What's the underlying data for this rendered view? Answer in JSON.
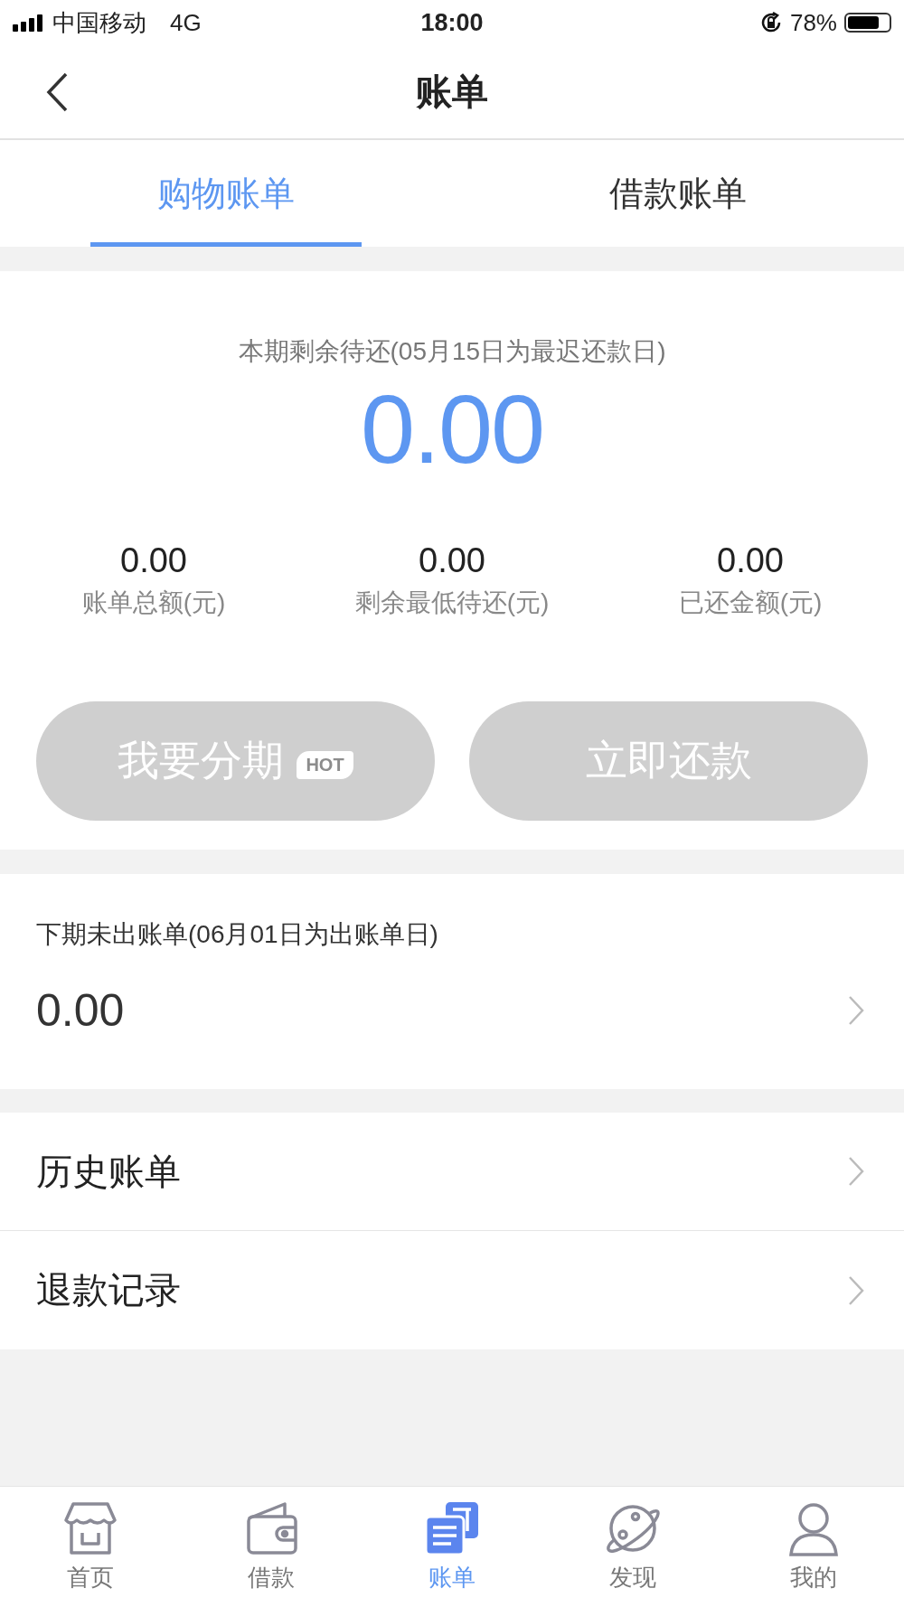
{
  "status_bar": {
    "carrier": "中国移动",
    "network": "4G",
    "time": "18:00",
    "battery": "78%"
  },
  "header": {
    "title": "账单"
  },
  "tabs": [
    {
      "label": "购物账单",
      "selected": true
    },
    {
      "label": "借款账单",
      "selected": false
    }
  ],
  "summary": {
    "caption": "本期剩余待还(05月15日为最迟还款日)",
    "amount": "0.00",
    "stats": [
      {
        "value": "0.00",
        "label": "账单总额(元)"
      },
      {
        "value": "0.00",
        "label": "剩余最低待还(元)"
      },
      {
        "value": "0.00",
        "label": "已还金额(元)"
      }
    ],
    "buttons": [
      {
        "label": "我要分期",
        "badge": "HOT",
        "disabled": true
      },
      {
        "label": "立即还款",
        "disabled": true
      }
    ]
  },
  "next_bill": {
    "caption": "下期未出账单(06月01日为出账单日)",
    "amount": "0.00"
  },
  "menu": [
    {
      "label": "历史账单"
    },
    {
      "label": "退款记录"
    }
  ],
  "bottom_nav": [
    {
      "label": "首页",
      "kind": "shop",
      "selected": false
    },
    {
      "label": "借款",
      "kind": "wallet",
      "selected": false
    },
    {
      "label": "账单",
      "kind": "bills",
      "selected": true
    },
    {
      "label": "发现",
      "kind": "planet",
      "selected": false
    },
    {
      "label": "我的",
      "kind": "person",
      "selected": false
    }
  ]
}
